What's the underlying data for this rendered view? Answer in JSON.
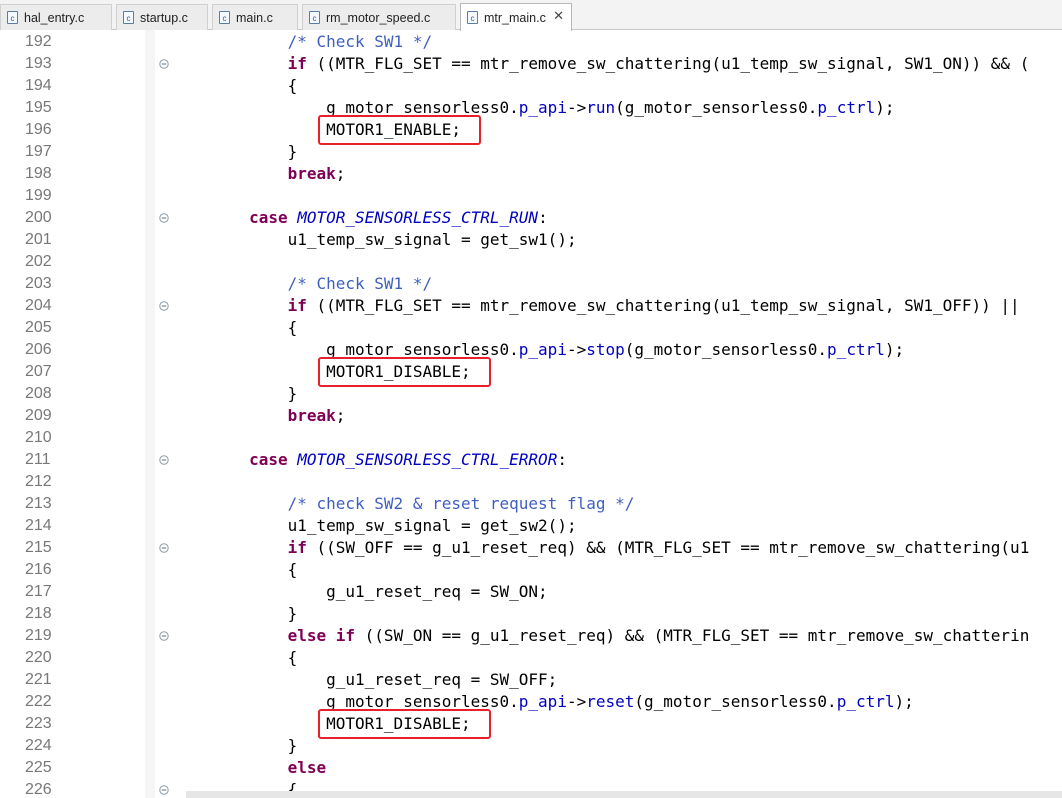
{
  "tabs": [
    {
      "label": "hal_entry.c",
      "active": false
    },
    {
      "label": "startup.c",
      "active": false
    },
    {
      "label": "main.c",
      "active": false
    },
    {
      "label": "rm_motor_speed.c",
      "active": false
    },
    {
      "label": "mtr_main.c",
      "active": true
    }
  ],
  "tab_close_glyph": "✕",
  "file_icon_glyph": "c",
  "colors": {
    "keyword": "#7f0055",
    "comment": "#3f5fbf",
    "field": "#0000c0",
    "line_number": "#787878",
    "highlight_box": "#e8202a"
  },
  "editor": {
    "lines": [
      {
        "n": "192",
        "fold": false,
        "tokens": [
          [
            "",
            "            "
          ],
          [
            "cm",
            "/* Check SW1 */"
          ]
        ]
      },
      {
        "n": "193",
        "fold": true,
        "tokens": [
          [
            "",
            "            "
          ],
          [
            "kw",
            "if"
          ],
          [
            "",
            " ((MTR_FLG_SET == mtr_remove_sw_chattering(u1_temp_sw_signal, SW1_ON)) && ("
          ]
        ]
      },
      {
        "n": "194",
        "fold": false,
        "tokens": [
          [
            "",
            "            {"
          ]
        ]
      },
      {
        "n": "195",
        "fold": false,
        "tokens": [
          [
            "",
            "                g_motor_sensorless0."
          ],
          [
            "fld",
            "p_api"
          ],
          [
            "",
            "->"
          ],
          [
            "fld",
            "run"
          ],
          [
            "",
            "(g_motor_sensorless0."
          ],
          [
            "fld",
            "p_ctrl"
          ],
          [
            "",
            ");"
          ]
        ]
      },
      {
        "n": "196",
        "fold": false,
        "tokens": [
          [
            "",
            "                MOTOR1_ENABLE;"
          ]
        ]
      },
      {
        "n": "197",
        "fold": false,
        "tokens": [
          [
            "",
            "            }"
          ]
        ]
      },
      {
        "n": "198",
        "fold": false,
        "tokens": [
          [
            "",
            "            "
          ],
          [
            "kw",
            "break"
          ],
          [
            "",
            ";"
          ]
        ]
      },
      {
        "n": "199",
        "fold": false,
        "tokens": [
          [
            "",
            ""
          ]
        ]
      },
      {
        "n": "200",
        "fold": true,
        "tokens": [
          [
            "",
            "        "
          ],
          [
            "kw",
            "case"
          ],
          [
            "",
            " "
          ],
          [
            "en",
            "MOTOR_SENSORLESS_CTRL_RUN"
          ],
          [
            "",
            ":"
          ]
        ]
      },
      {
        "n": "201",
        "fold": false,
        "tokens": [
          [
            "",
            "            u1_temp_sw_signal = get_sw1();"
          ]
        ]
      },
      {
        "n": "202",
        "fold": false,
        "tokens": [
          [
            "",
            ""
          ]
        ]
      },
      {
        "n": "203",
        "fold": false,
        "tokens": [
          [
            "",
            "            "
          ],
          [
            "cm",
            "/* Check SW1 */"
          ]
        ]
      },
      {
        "n": "204",
        "fold": true,
        "tokens": [
          [
            "",
            "            "
          ],
          [
            "kw",
            "if"
          ],
          [
            "",
            " ((MTR_FLG_SET == mtr_remove_sw_chattering(u1_temp_sw_signal, SW1_OFF)) ||"
          ]
        ]
      },
      {
        "n": "205",
        "fold": false,
        "tokens": [
          [
            "",
            "            {"
          ]
        ]
      },
      {
        "n": "206",
        "fold": false,
        "tokens": [
          [
            "",
            "                g_motor_sensorless0."
          ],
          [
            "fld",
            "p_api"
          ],
          [
            "",
            "->"
          ],
          [
            "fld",
            "stop"
          ],
          [
            "",
            "(g_motor_sensorless0."
          ],
          [
            "fld",
            "p_ctrl"
          ],
          [
            "",
            ");"
          ]
        ]
      },
      {
        "n": "207",
        "fold": false,
        "tokens": [
          [
            "",
            "                MOTOR1_DISABLE;"
          ]
        ]
      },
      {
        "n": "208",
        "fold": false,
        "tokens": [
          [
            "",
            "            }"
          ]
        ]
      },
      {
        "n": "209",
        "fold": false,
        "tokens": [
          [
            "",
            "            "
          ],
          [
            "kw",
            "break"
          ],
          [
            "",
            ";"
          ]
        ]
      },
      {
        "n": "210",
        "fold": false,
        "tokens": [
          [
            "",
            ""
          ]
        ]
      },
      {
        "n": "211",
        "fold": true,
        "tokens": [
          [
            "",
            "        "
          ],
          [
            "kw",
            "case"
          ],
          [
            "",
            " "
          ],
          [
            "en",
            "MOTOR_SENSORLESS_CTRL_ERROR"
          ],
          [
            "",
            ":"
          ]
        ]
      },
      {
        "n": "212",
        "fold": false,
        "tokens": [
          [
            "",
            ""
          ]
        ]
      },
      {
        "n": "213",
        "fold": false,
        "tokens": [
          [
            "",
            "            "
          ],
          [
            "cm",
            "/* check SW2 & reset request flag */"
          ]
        ]
      },
      {
        "n": "214",
        "fold": false,
        "tokens": [
          [
            "",
            "            u1_temp_sw_signal = get_sw2();"
          ]
        ]
      },
      {
        "n": "215",
        "fold": true,
        "tokens": [
          [
            "",
            "            "
          ],
          [
            "kw",
            "if"
          ],
          [
            "",
            " ((SW_OFF == g_u1_reset_req) && (MTR_FLG_SET == mtr_remove_sw_chattering(u1"
          ]
        ]
      },
      {
        "n": "216",
        "fold": false,
        "tokens": [
          [
            "",
            "            {"
          ]
        ]
      },
      {
        "n": "217",
        "fold": false,
        "tokens": [
          [
            "",
            "                g_u1_reset_req = SW_ON;"
          ]
        ]
      },
      {
        "n": "218",
        "fold": false,
        "tokens": [
          [
            "",
            "            }"
          ]
        ]
      },
      {
        "n": "219",
        "fold": true,
        "tokens": [
          [
            "",
            "            "
          ],
          [
            "kw",
            "else"
          ],
          [
            "",
            " "
          ],
          [
            "kw",
            "if"
          ],
          [
            "",
            " ((SW_ON == g_u1_reset_req) && (MTR_FLG_SET == mtr_remove_sw_chatterin"
          ]
        ]
      },
      {
        "n": "220",
        "fold": false,
        "tokens": [
          [
            "",
            "            {"
          ]
        ]
      },
      {
        "n": "221",
        "fold": false,
        "tokens": [
          [
            "",
            "                g_u1_reset_req = SW_OFF;"
          ]
        ]
      },
      {
        "n": "222",
        "fold": false,
        "tokens": [
          [
            "",
            "                g_motor_sensorless0."
          ],
          [
            "fld",
            "p_api"
          ],
          [
            "",
            "->"
          ],
          [
            "fld",
            "reset"
          ],
          [
            "",
            "(g_motor_sensorless0."
          ],
          [
            "fld",
            "p_ctrl"
          ],
          [
            "",
            ");"
          ]
        ]
      },
      {
        "n": "223",
        "fold": false,
        "tokens": [
          [
            "",
            "                MOTOR1_DISABLE;"
          ]
        ]
      },
      {
        "n": "224",
        "fold": false,
        "tokens": [
          [
            "",
            "            }"
          ]
        ]
      },
      {
        "n": "225",
        "fold": false,
        "tokens": [
          [
            "",
            "            "
          ],
          [
            "kw",
            "else"
          ]
        ]
      },
      {
        "n": "226",
        "fold": true,
        "tokens": [
          [
            "",
            "            {"
          ]
        ]
      }
    ],
    "highlighted_lines": [
      "196",
      "207",
      "223"
    ]
  }
}
